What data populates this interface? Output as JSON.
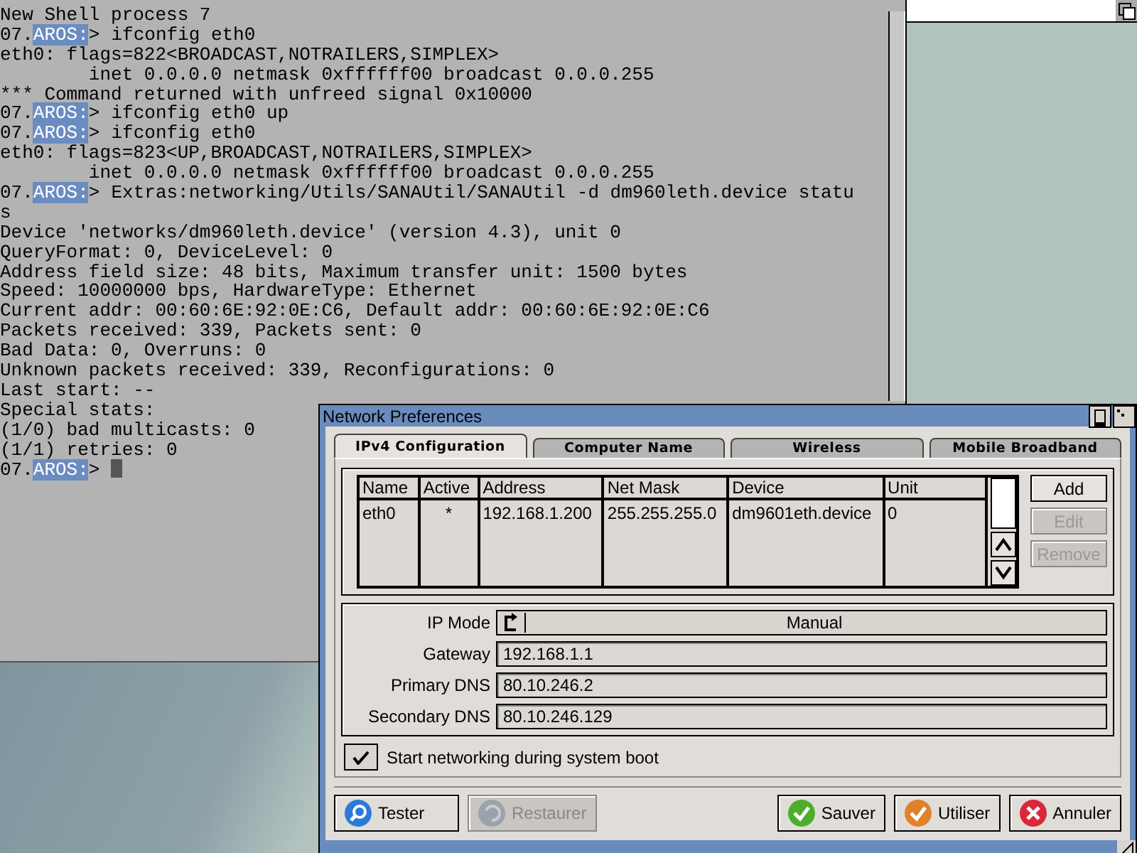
{
  "shell": {
    "lines": [
      {
        "kind": "output",
        "text": "New Shell process 7"
      },
      {
        "kind": "prompt",
        "number": "07.",
        "prompt": "AROS:",
        "sign": ">",
        "command": "ifconfig eth0"
      },
      {
        "kind": "output",
        "text": "eth0: flags=822<BROADCAST,NOTRAILERS,SIMPLEX>"
      },
      {
        "kind": "output",
        "text": "        inet 0.0.0.0 netmask 0xffffff00 broadcast 0.0.0.255"
      },
      {
        "kind": "output",
        "text": "*** Command returned with unfreed signal 0x10000"
      },
      {
        "kind": "prompt",
        "number": "07.",
        "prompt": "AROS:",
        "sign": ">",
        "command": "ifconfig eth0 up"
      },
      {
        "kind": "prompt",
        "number": "07.",
        "prompt": "AROS:",
        "sign": ">",
        "command": "ifconfig eth0"
      },
      {
        "kind": "output",
        "text": "eth0: flags=823<UP,BROADCAST,NOTRAILERS,SIMPLEX>"
      },
      {
        "kind": "output",
        "text": "        inet 0.0.0.0 netmask 0xffffff00 broadcast 0.0.0.255"
      },
      {
        "kind": "prompt",
        "number": "07.",
        "prompt": "AROS:",
        "sign": ">",
        "command": "Extras:networking/Utils/SANAUtil/SANAUtil -d dm960leth.device statu"
      },
      {
        "kind": "output",
        "text": "s"
      },
      {
        "kind": "output",
        "text": "Device 'networks/dm960leth.device' (version 4.3), unit 0"
      },
      {
        "kind": "output",
        "text": "QueryFormat: 0, DeviceLevel: 0"
      },
      {
        "kind": "output",
        "text": "Address field size: 48 bits, Maximum transfer unit: 1500 bytes"
      },
      {
        "kind": "output",
        "text": "Speed: 10000000 bps, HardwareType: Ethernet"
      },
      {
        "kind": "output",
        "text": "Current addr: 00:60:6E:92:0E:C6, Default addr: 00:60:6E:92:0E:C6"
      },
      {
        "kind": "output",
        "text": "Packets received: 339, Packets sent: 0"
      },
      {
        "kind": "output",
        "text": "Bad Data: 0, Overruns: 0"
      },
      {
        "kind": "output",
        "text": "Unknown packets received: 339, Reconfigurations: 0"
      },
      {
        "kind": "output",
        "text": "Last start: --"
      },
      {
        "kind": "output",
        "text": "Special stats:"
      },
      {
        "kind": "output",
        "text": "(1/0) bad multicasts: 0"
      },
      {
        "kind": "output",
        "text": "(1/1) retries: 0"
      },
      {
        "kind": "input",
        "number": "07.",
        "prompt": "AROS:",
        "sign": ">"
      }
    ]
  },
  "dialog": {
    "title": "Network Preferences",
    "tabs": [
      {
        "label": "IPv4 Configuration",
        "selected": true
      },
      {
        "label": "Computer Name",
        "selected": false
      },
      {
        "label": "Wireless",
        "selected": false
      },
      {
        "label": "Mobile Broadband",
        "selected": false
      }
    ],
    "table": {
      "columns": [
        "Name",
        "Active",
        "Address",
        "Net Mask",
        "Device",
        "Unit"
      ],
      "rows": [
        [
          "eth0",
          "*",
          "192.168.1.200",
          "255.255.255.0",
          "dm9601eth.device",
          "0"
        ]
      ]
    },
    "list_buttons": [
      {
        "label": "Add",
        "disabled": false
      },
      {
        "label": "Edit",
        "disabled": true
      },
      {
        "label": "Remove",
        "disabled": true
      }
    ],
    "ip_mode": {
      "label": "IP Mode",
      "value": "Manual"
    },
    "fields": [
      {
        "label": "Gateway",
        "value": "192.168.1.1"
      },
      {
        "label": "Primary DNS",
        "value": "80.10.246.2"
      },
      {
        "label": "Secondary DNS",
        "value": "80.10.246.129"
      }
    ],
    "boot_option": {
      "label": "Start networking during system boot",
      "checked": true
    },
    "buttons": [
      {
        "label": "Tester",
        "kind": "test",
        "disabled": false
      },
      {
        "label": "Restaurer",
        "kind": "restore",
        "disabled": true
      },
      {
        "label": "Sauver",
        "kind": "save",
        "disabled": false
      },
      {
        "label": "Utiliser",
        "kind": "use",
        "disabled": false
      },
      {
        "label": "Annuler",
        "kind": "cancel",
        "disabled": false
      }
    ]
  }
}
